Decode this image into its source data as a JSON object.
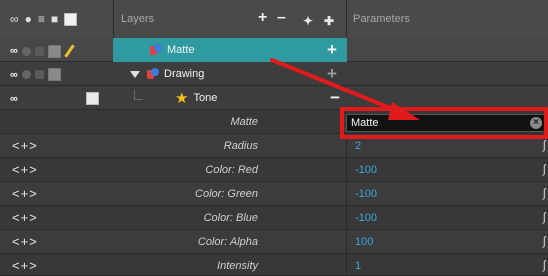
{
  "header": {
    "layers_label": "Layers",
    "parameters_label": "Parameters",
    "icons": [
      "infinity-icon",
      "circle-icon",
      "stack-icon",
      "lock-icon",
      "square-icon"
    ],
    "buttons": [
      "add-layer-icon",
      "remove-layer-icon",
      "add-peg-icon",
      "add-effect-icon"
    ]
  },
  "layers": [
    {
      "name": "Matte",
      "icon": "matte-icon",
      "control": "+",
      "selected": true
    },
    {
      "name": "Drawing",
      "icon": "matte-icon",
      "control": "+",
      "expanded": true
    },
    {
      "name": "Tone",
      "icon": "star-icon",
      "control": "−"
    }
  ],
  "parameters": [
    {
      "name": "Matte",
      "value": "Matte",
      "editable_text": true
    },
    {
      "name": "Radius",
      "value": "2"
    },
    {
      "name": "Color: Red",
      "value": "-100"
    },
    {
      "name": "Color: Green",
      "value": "-100"
    },
    {
      "name": "Color: Blue",
      "value": "-100"
    },
    {
      "name": "Color: Alpha",
      "value": "100"
    },
    {
      "name": "Intensity",
      "value": "1"
    }
  ],
  "param_nav_label": "<+>",
  "colors": {
    "selection": "#2f9aa0",
    "value_text": "#39a7e0",
    "annotation": "#e11b1b"
  }
}
